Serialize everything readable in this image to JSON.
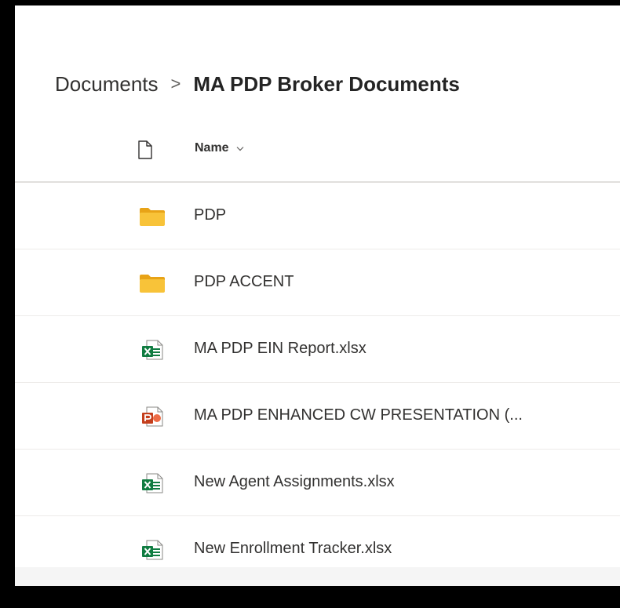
{
  "breadcrumb": {
    "root": "Documents",
    "separator": ">",
    "current": "MA PDP Broker Documents"
  },
  "list_header": {
    "file_type_icon": "file-icon",
    "name_label": "Name",
    "sort_icon": "chevron-down-icon"
  },
  "items": [
    {
      "label": "PDP",
      "type": "folder",
      "icon": "folder-icon"
    },
    {
      "label": "PDP ACCENT",
      "type": "folder",
      "icon": "folder-icon"
    },
    {
      "label": "MA PDP EIN Report.xlsx",
      "type": "excel",
      "icon": "excel-file-icon"
    },
    {
      "label": "MA PDP ENHANCED CW PRESENTATION (...",
      "type": "powerpoint",
      "icon": "powerpoint-file-icon"
    },
    {
      "label": "New Agent Assignments.xlsx",
      "type": "excel",
      "icon": "excel-file-icon"
    },
    {
      "label": "New Enrollment Tracker.xlsx",
      "type": "excel",
      "icon": "excel-file-icon"
    }
  ],
  "colors": {
    "folder": "#f8c339",
    "excel": "#107c41",
    "powerpoint": "#c43e1c",
    "text": "#323130"
  }
}
